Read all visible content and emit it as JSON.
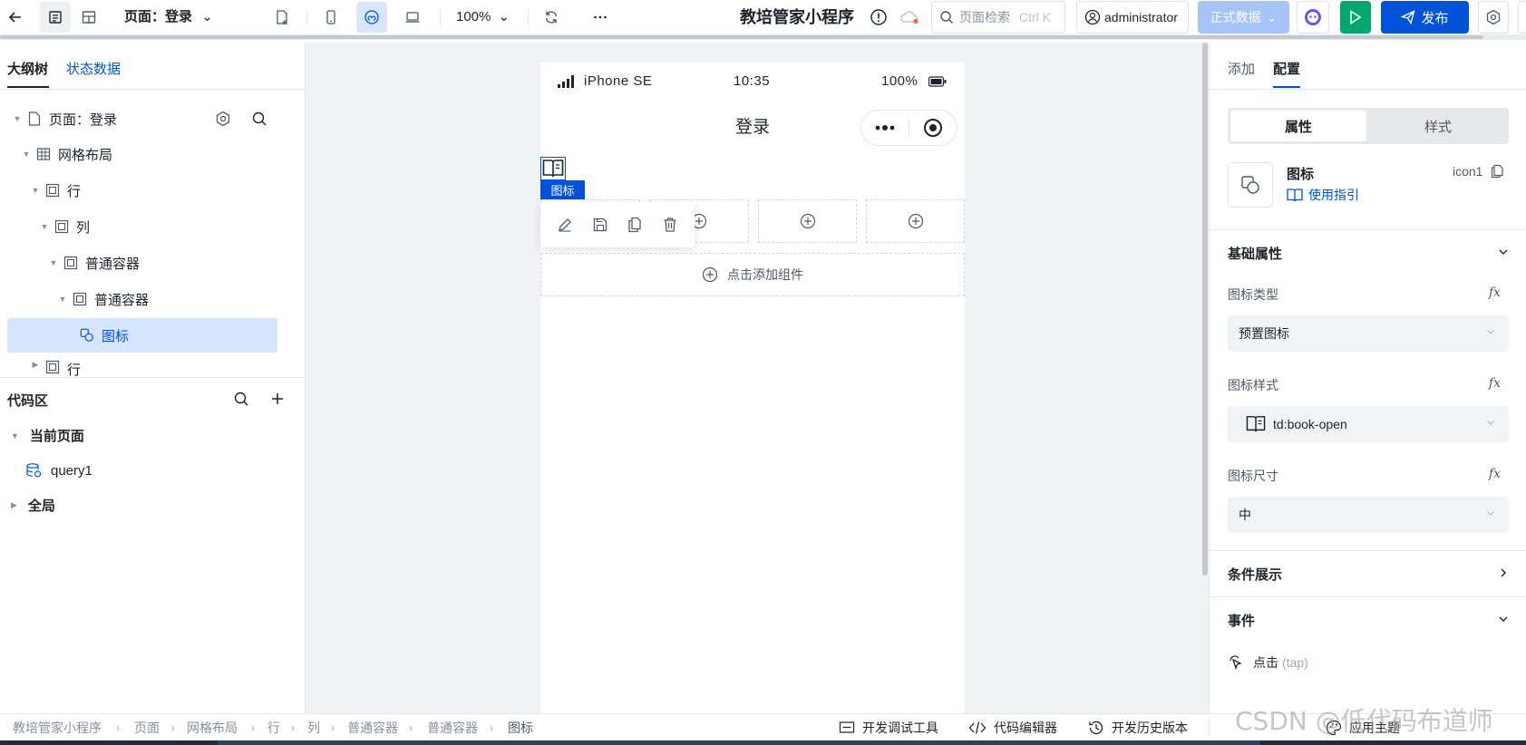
{
  "toolbar": {
    "page_selector": "页面：登录",
    "zoom": "100%",
    "app_title": "教培管家小程序",
    "search_placeholder": "页面检索",
    "search_shortcut": "Ctrl K",
    "user": "administrator",
    "env_label": "正式数据",
    "publish_label": "发布"
  },
  "left": {
    "tabs": [
      "大纲树",
      "状态数据"
    ],
    "tree": [
      {
        "label": "页面：登录"
      },
      {
        "label": "网格布局"
      },
      {
        "label": "行"
      },
      {
        "label": "列"
      },
      {
        "label": "普通容器"
      },
      {
        "label": "普通容器"
      },
      {
        "label": "图标"
      },
      {
        "label": "行"
      }
    ],
    "code_title": "代码区",
    "current_page": "当前页面",
    "query": "query1",
    "global": "全局"
  },
  "phone": {
    "device": "iPhone SE",
    "time": "10:35",
    "battery": "100%",
    "title": "登录",
    "selected_tag": "图标",
    "add_component": "点击添加组件"
  },
  "right": {
    "tabs": [
      "添加",
      "配置"
    ],
    "sub_tabs": [
      "属性",
      "样式"
    ],
    "component_name": "图标",
    "component_id": "icon1",
    "guide_link": "使用指引",
    "basic_section": "基础属性",
    "icon_type_label": "图标类型",
    "icon_type_value": "预置图标",
    "icon_style_label": "图标样式",
    "icon_style_value": "td:book-open",
    "icon_size_label": "图标尺寸",
    "icon_size_value": "中",
    "conditional_section": "条件展示",
    "events_section": "事件",
    "event_item": "点击",
    "event_item_code": "(tap)"
  },
  "bottom": {
    "breadcrumbs": [
      "教培管家小程序",
      "页面",
      "网格布局",
      "行",
      "列",
      "普通容器",
      "普通容器",
      "图标"
    ],
    "dev_tools": "开发调试工具",
    "code_editor": "代码编辑器",
    "history": "开发历史版本",
    "theme": "应用主题"
  },
  "watermark": "CSDN @低代码布道师",
  "colors": {
    "primary": "#0052d9",
    "green": "#00a870",
    "env_button": "#a6c4f7",
    "selected_bg": "#d6e4fc"
  }
}
